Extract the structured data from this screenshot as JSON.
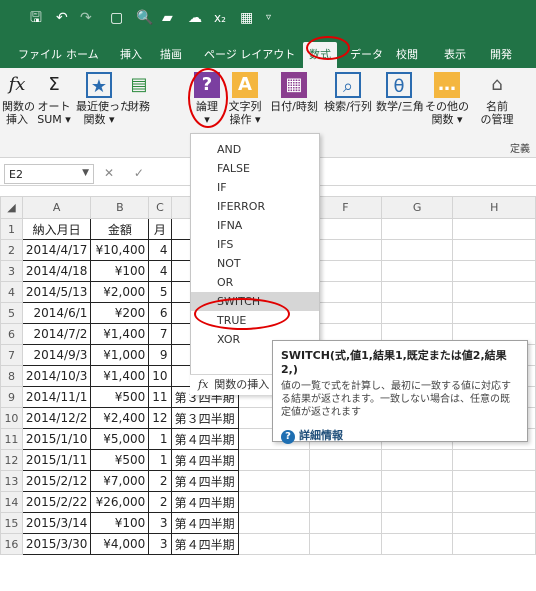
{
  "qat": {
    "icons": [
      "save-icon",
      "undo-icon",
      "redo-icon",
      "new-icon",
      "print-preview-icon",
      "open-icon",
      "cloud-icon",
      "subscript-icon",
      "table-icon",
      "customize-icon"
    ]
  },
  "tabs": [
    "ファイル",
    "ホーム",
    "挿入",
    "描画",
    "ページ レイアウト",
    "数式",
    "データ",
    "校閲",
    "表示",
    "開発"
  ],
  "ribbon": {
    "insert_fn": "関数の\n挿入",
    "autosum": "オート\nSUM ▾",
    "recent": "最近使った\n関数 ▾",
    "finance": "財務",
    "logical": "論理\n▾",
    "text": "文字列\n操作 ▾",
    "datetime": "日付/時刻",
    "lookup": "検索/行列",
    "math": "数学/三角",
    "other": "その他の\n関数 ▾",
    "names": "名前\nの管理",
    "group_label": "定義"
  },
  "namebox": "E2",
  "formula_icons": "✕ ✓",
  "columns": [
    "A",
    "B",
    "C",
    "D",
    "E",
    "F",
    "G",
    "H"
  ],
  "rows": [
    {
      "n": "1",
      "a": "納入月日",
      "b": "金額",
      "c": "月",
      "d": ""
    },
    {
      "n": "2",
      "a": "2014/4/17",
      "b": "¥10,400",
      "c": "4",
      "d": ""
    },
    {
      "n": "3",
      "a": "2014/4/18",
      "b": "¥100",
      "c": "4",
      "d": ""
    },
    {
      "n": "4",
      "a": "2014/5/13",
      "b": "¥2,000",
      "c": "5",
      "d": ""
    },
    {
      "n": "5",
      "a": "2014/6/1",
      "b": "¥200",
      "c": "6",
      "d": ""
    },
    {
      "n": "6",
      "a": "2014/7/2",
      "b": "¥1,400",
      "c": "7",
      "d": ""
    },
    {
      "n": "7",
      "a": "2014/9/3",
      "b": "¥1,000",
      "c": "9",
      "d": ""
    },
    {
      "n": "8",
      "a": "2014/10/3",
      "b": "¥1,400",
      "c": "10",
      "d": ""
    },
    {
      "n": "9",
      "a": "2014/11/1",
      "b": "¥500",
      "c": "11",
      "d": "第３四半期"
    },
    {
      "n": "10",
      "a": "2014/12/2",
      "b": "¥2,400",
      "c": "12",
      "d": "第３四半期"
    },
    {
      "n": "11",
      "a": "2015/1/10",
      "b": "¥5,000",
      "c": "1",
      "d": "第４四半期"
    },
    {
      "n": "12",
      "a": "2015/1/11",
      "b": "¥500",
      "c": "1",
      "d": "第４四半期"
    },
    {
      "n": "13",
      "a": "2015/2/12",
      "b": "¥7,000",
      "c": "2",
      "d": "第４四半期"
    },
    {
      "n": "14",
      "a": "2015/2/22",
      "b": "¥26,000",
      "c": "2",
      "d": "第４四半期"
    },
    {
      "n": "15",
      "a": "2015/3/14",
      "b": "¥100",
      "c": "3",
      "d": "第４四半期"
    },
    {
      "n": "16",
      "a": "2015/3/30",
      "b": "¥4,000",
      "c": "3",
      "d": "第４四半期"
    }
  ],
  "dropdown": {
    "items": [
      "AND",
      "FALSE",
      "IF",
      "IFERROR",
      "IFNA",
      "IFS",
      "NOT",
      "OR",
      "SWITCH",
      "TRUE",
      "XOR"
    ],
    "highlighted": "SWITCH",
    "insert_fn": "関数の挿入"
  },
  "tooltip": {
    "title": "SWITCH(式,値1,結果1,既定または値2,結果2,)",
    "desc": "値の一覧で式を計算し、最初に一致する値に対応する結果が返されます。一致しない場合は、任意の既定値が返されます",
    "link": "詳細情報"
  },
  "colors": {
    "accent": "#217346",
    "highlight_oval": "#e00000"
  }
}
